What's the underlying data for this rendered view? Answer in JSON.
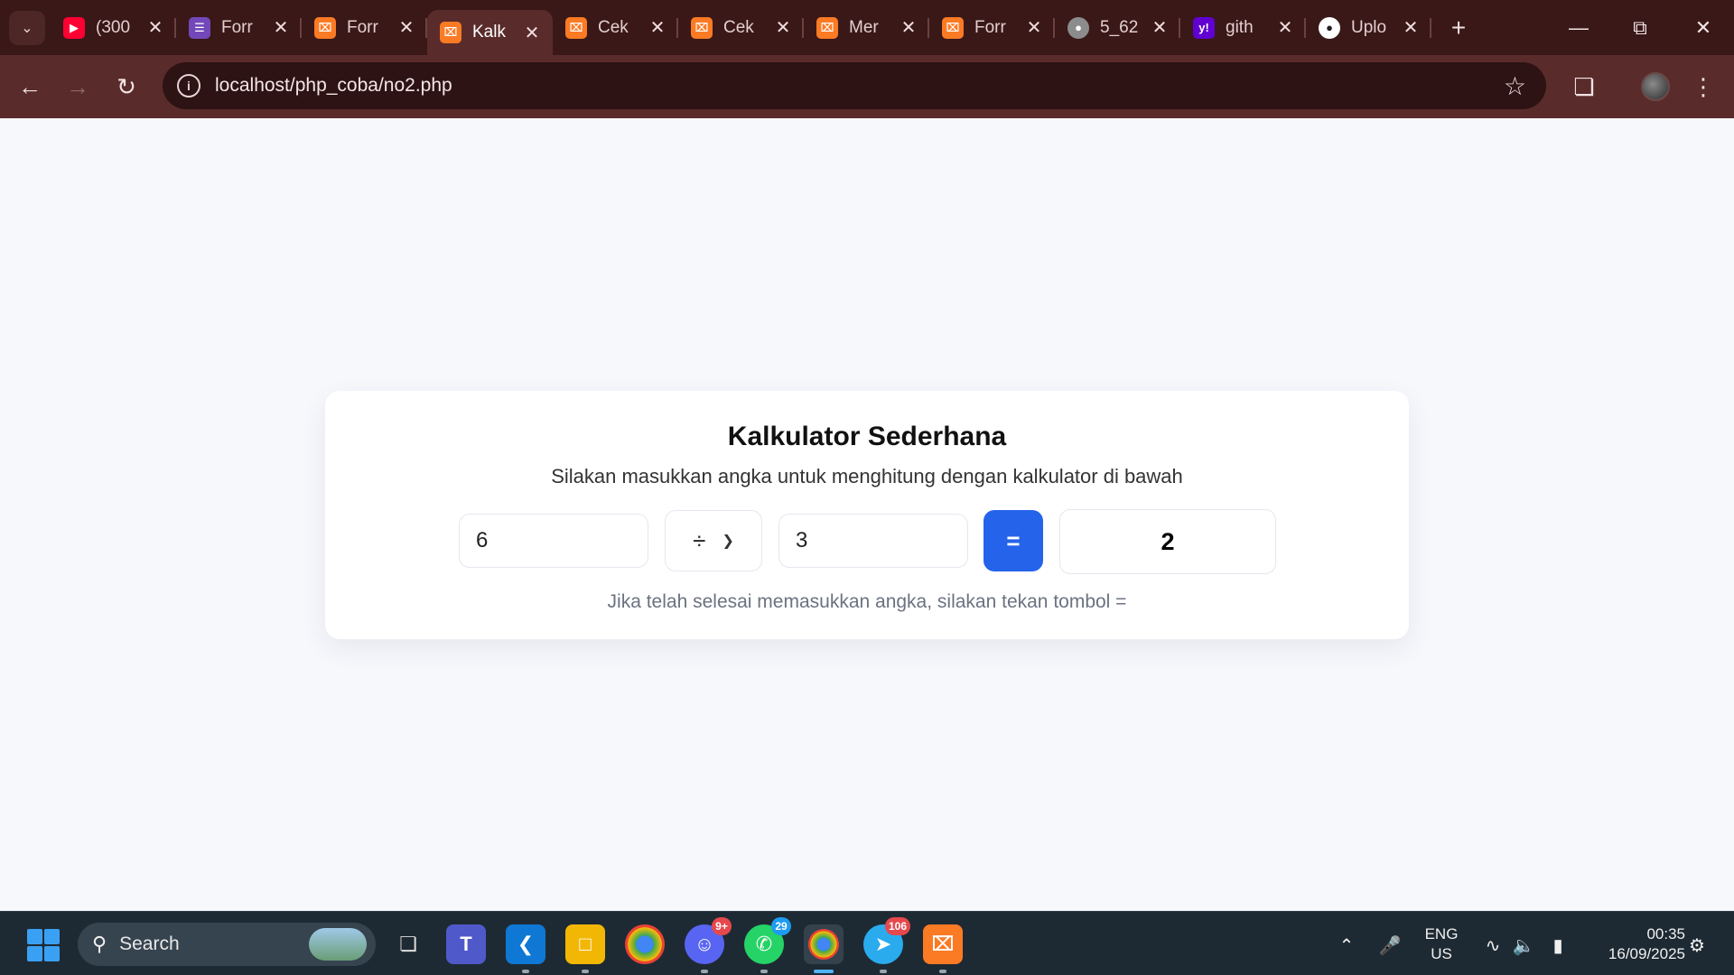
{
  "browser": {
    "tabs": [
      {
        "title": "(300",
        "favicon": "youtube-icon",
        "active": false
      },
      {
        "title": "Forr",
        "favicon": "forms-icon",
        "active": false
      },
      {
        "title": "Forr",
        "favicon": "xampp-icon",
        "active": false
      },
      {
        "title": "Kalk",
        "favicon": "xampp-icon",
        "active": true
      },
      {
        "title": "Cek",
        "favicon": "xampp-icon",
        "active": false
      },
      {
        "title": "Cek",
        "favicon": "xampp-icon",
        "active": false
      },
      {
        "title": "Mer",
        "favicon": "xampp-icon",
        "active": false
      },
      {
        "title": "Forr",
        "favicon": "xampp-icon",
        "active": false
      },
      {
        "title": "5_62",
        "favicon": "globe-icon",
        "active": false
      },
      {
        "title": "gith",
        "favicon": "yahoo-icon",
        "active": false
      },
      {
        "title": "Uplo",
        "favicon": "github-icon",
        "active": false
      }
    ],
    "address": "localhost/php_coba/no2.php",
    "accent_color": "#5a2b2b"
  },
  "calculator": {
    "title": "Kalkulator Sederhana",
    "subtitle": "Silakan masukkan angka untuk menghitung dengan kalkulator di bawah",
    "first_number": "6",
    "operator": "÷",
    "second_number": "3",
    "equals_label": "=",
    "result": "2",
    "hint": "Jika telah selesai memasukkan angka, silakan tekan tombol =",
    "button_color": "#2563eb"
  },
  "taskbar": {
    "search_label": "Search",
    "apps": [
      {
        "name": "task-view",
        "badge": ""
      },
      {
        "name": "teams",
        "badge": ""
      },
      {
        "name": "vscode",
        "badge": ""
      },
      {
        "name": "file-explorer",
        "badge": ""
      },
      {
        "name": "chrome",
        "badge": ""
      },
      {
        "name": "discord",
        "badge": "9+"
      },
      {
        "name": "whatsapp",
        "badge": "29"
      },
      {
        "name": "chrome-active",
        "badge": ""
      },
      {
        "name": "telegram",
        "badge": "106"
      },
      {
        "name": "xampp",
        "badge": ""
      }
    ],
    "language": "ENG",
    "region": "US",
    "time": "00:35",
    "date": "16/09/2025"
  }
}
